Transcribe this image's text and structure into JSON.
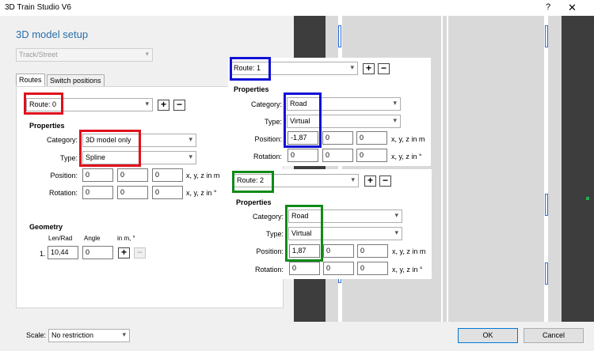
{
  "window": {
    "title": "3D Train Studio V6",
    "help": "?",
    "close": "✕"
  },
  "heading": "3D model setup",
  "model_type": "Track/Street",
  "tabs": [
    "Routes",
    "Switch positions"
  ],
  "route0": {
    "route": "Route: 0",
    "properties_title": "Properties",
    "category_label": "Category:",
    "category": "3D model only",
    "type_label": "Type:",
    "type": "Spline",
    "position_label": "Position:",
    "position": [
      "0",
      "0",
      "0"
    ],
    "position_unit": "x, y, z in m",
    "rotation_label": "Rotation:",
    "rotation": [
      "0",
      "0",
      "0"
    ],
    "rotation_unit": "x, y, z in °"
  },
  "geometry": {
    "title": "Geometry",
    "col_lenrad": "Len/Rad",
    "col_angle": "Angle",
    "col_unit": "in m, °",
    "row_index": "1.",
    "lenrad": "10,44",
    "angle": "0"
  },
  "route1": {
    "route": "Route: 1",
    "properties_title": "Properties",
    "category_label": "Category:",
    "category": "Road",
    "type_label": "Type:",
    "type": "Virtual",
    "position_label": "Position:",
    "position": [
      "-1,87",
      "0",
      "0"
    ],
    "position_unit": "x, y, z in m",
    "rotation_label": "Rotation:",
    "rotation": [
      "0",
      "0",
      "0"
    ],
    "rotation_unit": "x, y, z in °"
  },
  "route2": {
    "route": "Route: 2",
    "properties_title": "Properties",
    "category_label": "Category:",
    "category": "Road",
    "type_label": "Type:",
    "type": "Virtual",
    "position_label": "Position:",
    "position": [
      "1,87",
      "0",
      "0"
    ],
    "position_unit": "x, y, z in m",
    "rotation_label": "Rotation:",
    "rotation": [
      "0",
      "0",
      "0"
    ],
    "rotation_unit": "x, y, z in °"
  },
  "footer": {
    "scale_label": "Scale:",
    "scale": "No restriction",
    "ok": "OK",
    "cancel": "Cancel"
  },
  "buttons": {
    "plus": "+",
    "minus": "−"
  },
  "icons": {
    "dropdown": "chevron-down-icon",
    "add": "plus-icon",
    "remove": "minus-icon"
  },
  "colors": {
    "heading": "#2a6fad",
    "highlight_route0": "#e0101d",
    "highlight_route1": "#1010d8",
    "highlight_route2": "#118a18"
  }
}
